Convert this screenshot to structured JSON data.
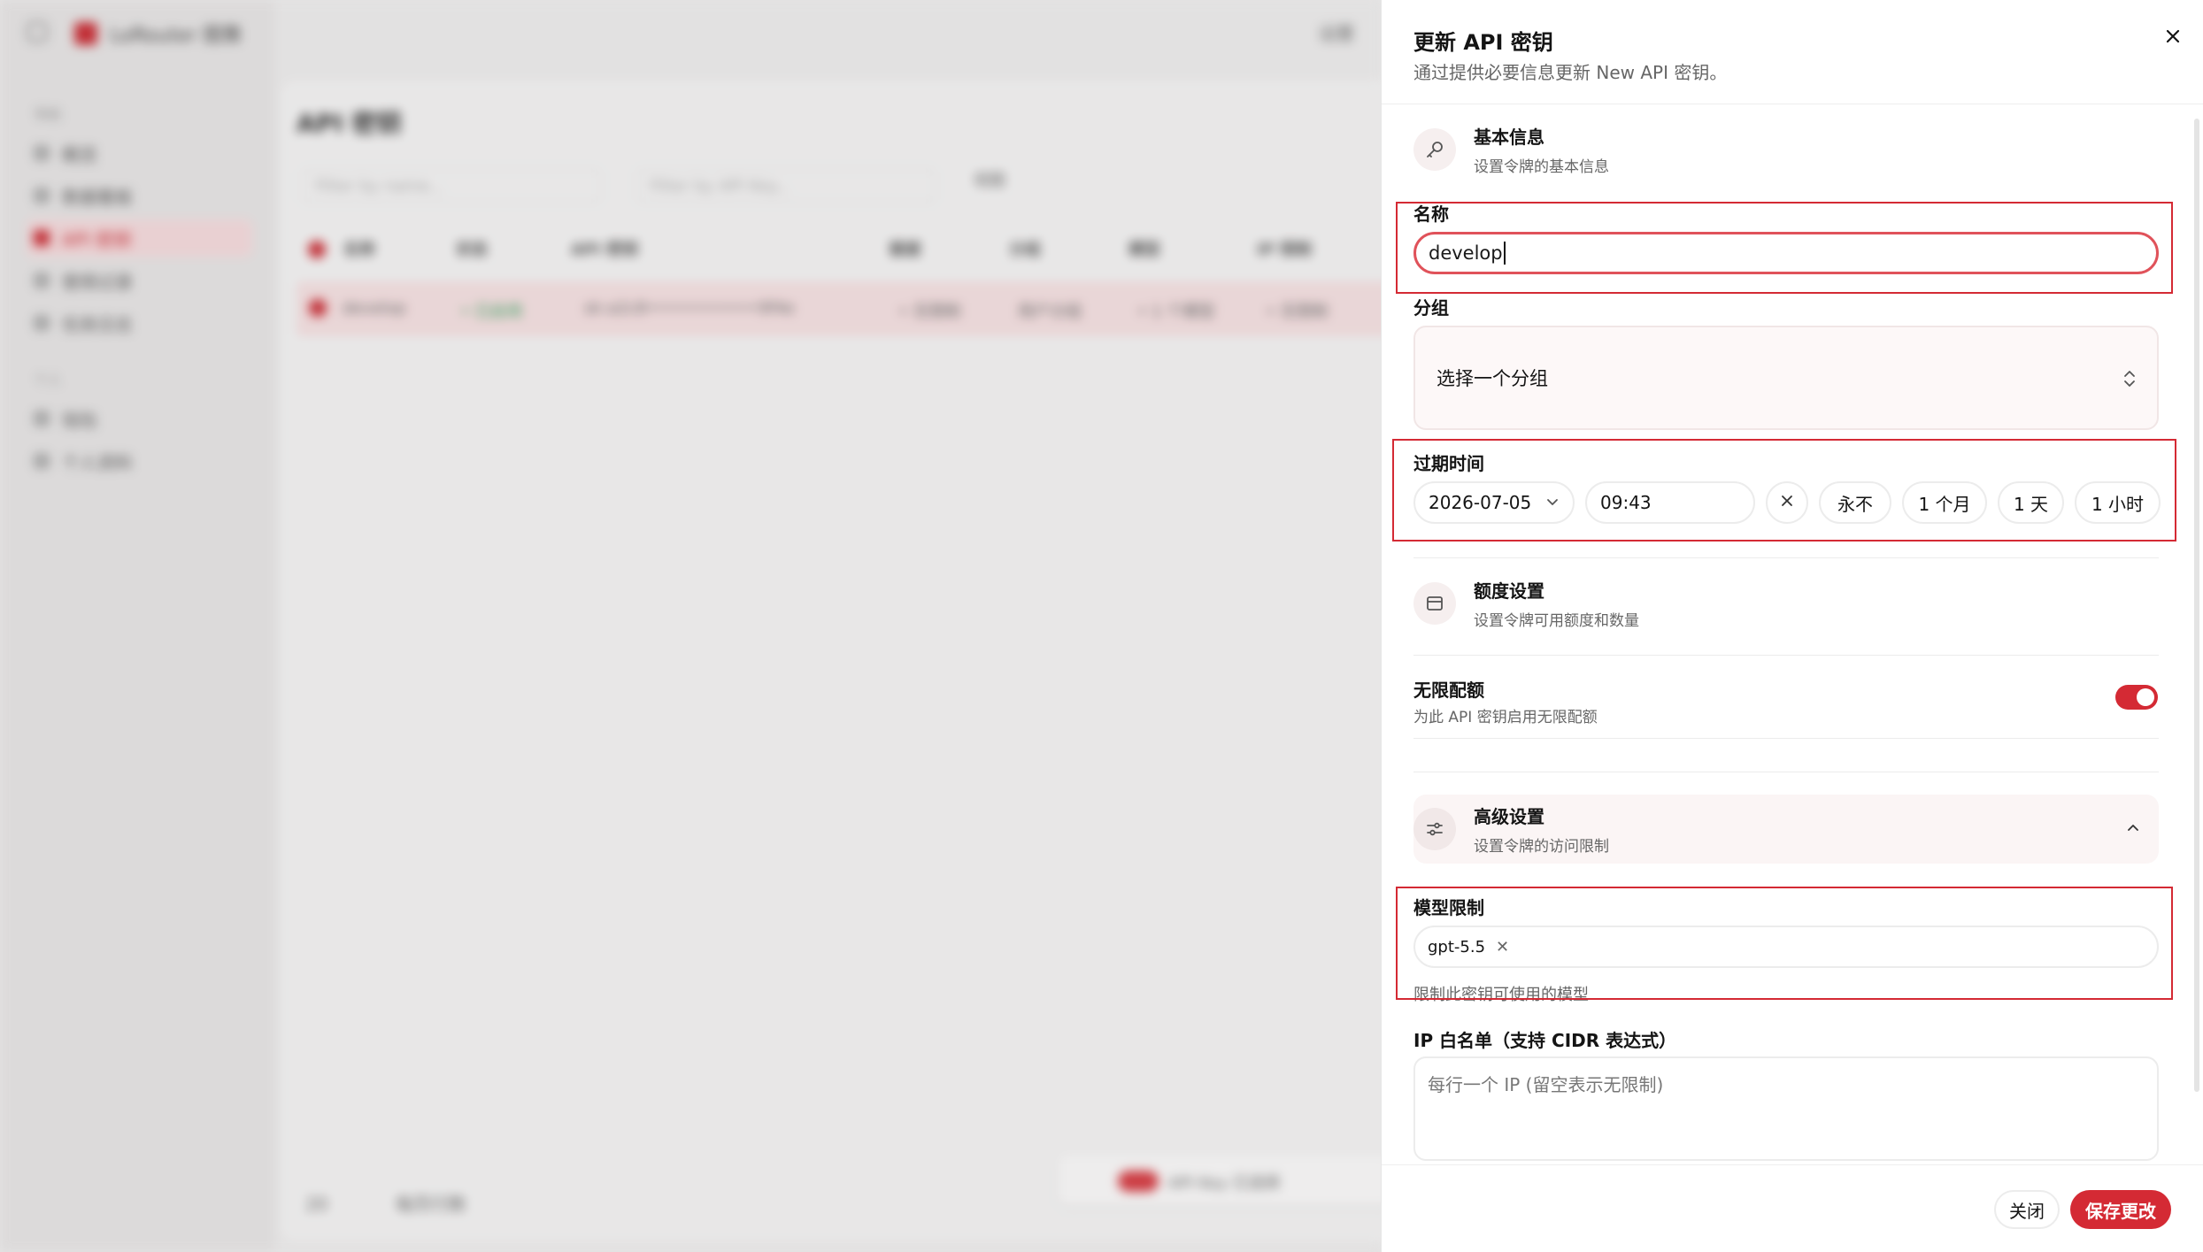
{
  "background": {
    "brand": "LoRouter 图策",
    "group1": "导航",
    "nav": [
      "概览",
      "数据看板",
      "API 密钥",
      "使用记录",
      "任务日志"
    ],
    "active_nav_index": 2,
    "group2": "个人",
    "nav2": [
      "钱包",
      "个人资料"
    ],
    "top_link": "设置",
    "page_title": "API 密钥",
    "filter_name_placeholder": "Filter by name...",
    "filter_key_placeholder": "Filter by API Key...",
    "view_label": "视图",
    "columns": [
      "名称",
      "状态",
      "API 密钥",
      "额度",
      "分组",
      "模型",
      "IP 限制"
    ],
    "row": {
      "name": "develop",
      "status": "• 已启用",
      "key": "sk-a2c8••••••••••••9f4e",
      "quota": "• 无限制",
      "group": "用户分组",
      "models": "• 1 个模型",
      "ip": "• 无限制"
    },
    "pager": "每页行数",
    "page_num": "20",
    "float_count": "1",
    "float_text": "API Key 已选择"
  },
  "drawer": {
    "title": "更新 API 密钥",
    "subtitle": "通过提供必要信息更新 New API 密钥。",
    "basic": {
      "title": "基本信息",
      "subtitle": "设置令牌的基本信息"
    },
    "name_label": "名称",
    "name_value": "develop",
    "group_label": "分组",
    "group_placeholder": "选择一个分组",
    "expiry_label": "过期时间",
    "expiry_date": "2026-07-05",
    "expiry_time": "09:43",
    "quick": [
      "永不",
      "1 个月",
      "1 天",
      "1 小时"
    ],
    "quota": {
      "title": "额度设置",
      "subtitle": "设置令牌可用额度和数量"
    },
    "unlimited_label": "无限配额",
    "unlimited_sub": "为此 API 密钥启用无限配额",
    "unlimited_on": true,
    "advanced": {
      "title": "高级设置",
      "subtitle": "设置令牌的访问限制"
    },
    "model_label": "模型限制",
    "models": [
      "gpt-5.5"
    ],
    "model_help": "限制此密钥可使用的模型",
    "ip_label": "IP 白名单（支持 CIDR 表达式）",
    "ip_placeholder": "每行一个 IP (留空表示无限制)",
    "close_label": "关闭",
    "save_label": "保存更改"
  },
  "colors": {
    "accent": "#d42a34",
    "highlight_box": "#d42a34"
  },
  "icons": {
    "close": "close-icon",
    "basic": "key-icon",
    "group_select": "chevron-up-down-icon",
    "date": "chevron-down-icon",
    "clear": "x-icon",
    "quota": "wallet-icon",
    "advanced": "sliders-icon",
    "collapse": "chevron-up-icon"
  }
}
